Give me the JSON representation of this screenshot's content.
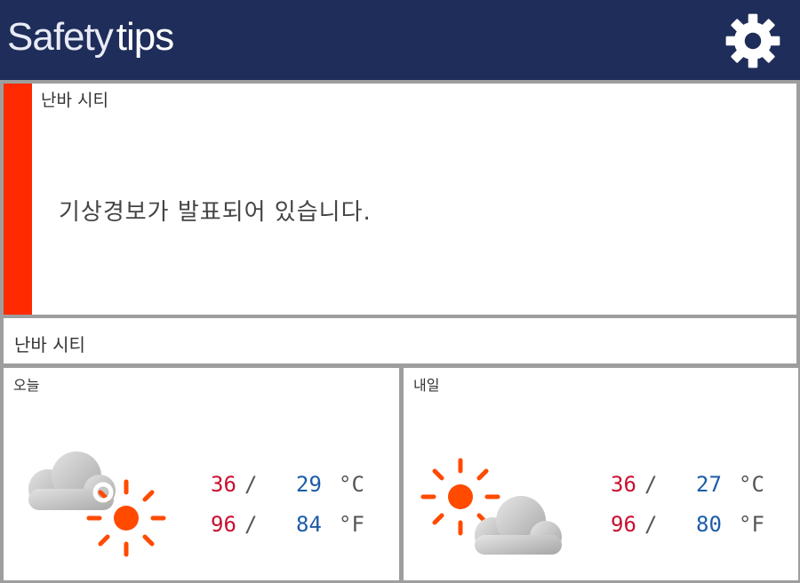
{
  "header": {
    "brand_part1": "Safety",
    "brand_part2": "tips",
    "settings_icon": "gear-icon"
  },
  "alert": {
    "city": "난바 시티",
    "message": "기상경보가 발표되어 있습니다.",
    "color": "#ff2a00"
  },
  "city_label": "난바 시티",
  "forecast": {
    "today": {
      "label": "오늘",
      "icon": "cloud-then-sun-icon",
      "high_c": "36",
      "low_c": "29",
      "high_f": "96",
      "low_f": "84"
    },
    "tomorrow": {
      "label": "내일",
      "icon": "sun-then-cloud-icon",
      "high_c": "36",
      "low_c": "27",
      "high_f": "96",
      "low_f": "80"
    },
    "separator": "/",
    "unit_c": "°C",
    "unit_f": "°F"
  },
  "colors": {
    "header_bg": "#1f2d5a",
    "high_temp": "#c8102e",
    "low_temp": "#1c5ca8",
    "sun": "#ff4a00"
  }
}
